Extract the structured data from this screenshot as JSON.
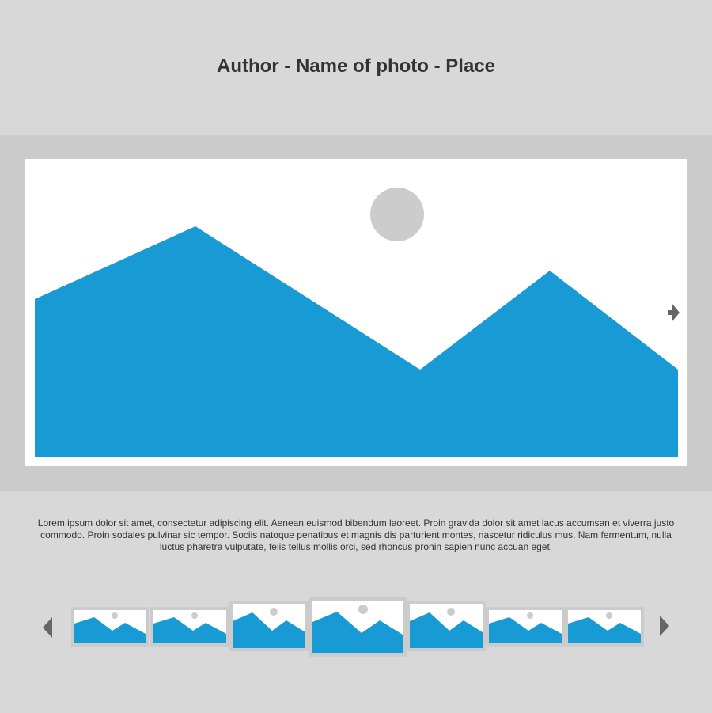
{
  "header": {
    "title": "Author - Name of photo - Place"
  },
  "viewer": {
    "main_photo_icon": "landscape-photo-placeholder",
    "next_icon": "arrow-right-icon"
  },
  "caption": {
    "text": "Lorem ipsum dolor sit amet, consectetur adipiscing elit. Aenean euismod bibendum laoreet. Proin gravida dolor sit amet lacus accumsan et viverra justo commodo. Proin sodales pulvinar sic tempor. Sociis natoque penatibus et magnis dis parturient montes, nascetur ridiculus mus. Nam fermentum, nulla luctus pharetra vulputate, felis tellus mollis orci, sed rhoncus pronin sapien nunc accuan eget."
  },
  "thumbnails": {
    "prev_icon": "arrow-left-icon",
    "next_icon": "arrow-right-icon",
    "count": 7,
    "selected_index": 3
  },
  "colors": {
    "mountain": "#189bd4",
    "sun": "#cccccc",
    "frame": "#cbcbcb",
    "background": "#d8d8d8",
    "text": "#333333"
  }
}
